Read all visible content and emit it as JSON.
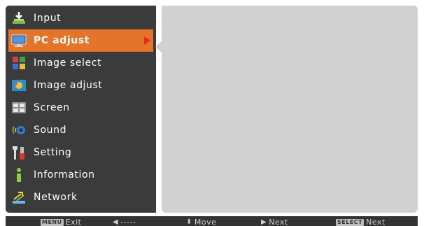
{
  "menu": {
    "items": [
      {
        "label": "Input",
        "icon": "input-icon"
      },
      {
        "label": "PC adjust",
        "icon": "pc-adjust-icon",
        "selected": true
      },
      {
        "label": "Image select",
        "icon": "image-select-icon"
      },
      {
        "label": "Image adjust",
        "icon": "image-adjust-icon"
      },
      {
        "label": "Screen",
        "icon": "screen-icon"
      },
      {
        "label": "Sound",
        "icon": "sound-icon"
      },
      {
        "label": "Setting",
        "icon": "setting-icon"
      },
      {
        "label": "Information",
        "icon": "information-icon"
      },
      {
        "label": "Network",
        "icon": "network-icon"
      }
    ]
  },
  "help_bar": {
    "exit_key": "MENU",
    "exit_label": "Exit",
    "back_label": "-----",
    "move_label": "Move",
    "next_label": "Next",
    "select_key": "SELECT",
    "select_label": "Next"
  },
  "colors": {
    "menu_bg": "#3b3b3b",
    "selected_bg": "#e3742a",
    "content_bg": "#d1d1d1",
    "arrow": "#e82a1c"
  }
}
